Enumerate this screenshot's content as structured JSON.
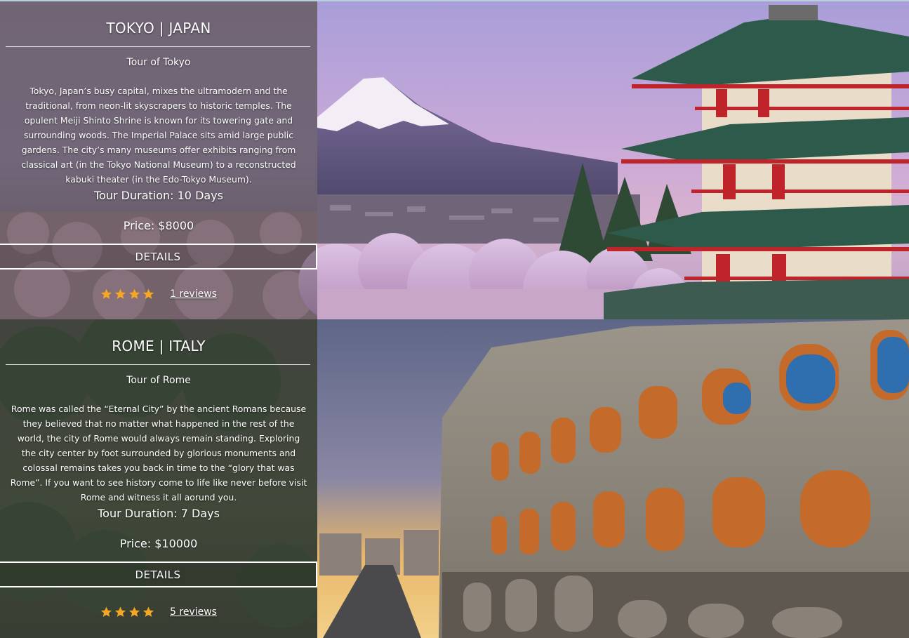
{
  "tours": [
    {
      "title": "TOKYO | JAPAN",
      "subtitle": "Tour of Tokyo",
      "description": "Tokyo, Japan’s busy capital, mixes the ultramodern and the traditional, from neon-lit skyscrapers to historic temples. The opulent Meiji Shinto Shrine is known for its towering gate and surrounding woods. The Imperial Palace sits amid large public gardens. The city’s many museums offer exhibits ranging from classical art (in the Tokyo National Museum) to a reconstructed kabuki theater (in the Edo-Tokyo Museum).",
      "duration": "Tour Duration: 10 Days",
      "price": "Price: $8000",
      "details_label": "DETAILS",
      "rating": 4,
      "reviews_label": "1 reviews"
    },
    {
      "title": "ROME | ITALY",
      "subtitle": "Tour of Rome",
      "description": "Rome was called the “Eternal City” by the ancient Romans because they believed that no matter what happened in the rest of the world, the city of Rome would always remain standing. Exploring the city center by foot surrounded by glorious monuments and colossal remains takes you back in time to the “glory that was Rome”. If you want to see history come to life like never before visit Rome and witness it all aorund you.",
      "duration": "Tour Duration: 7 Days",
      "price": "Price: $10000",
      "details_label": "DETAILS",
      "rating": 4,
      "reviews_label": "5 reviews"
    }
  ],
  "colors": {
    "star": "#f5a623",
    "panel_text": "#ffffff"
  }
}
